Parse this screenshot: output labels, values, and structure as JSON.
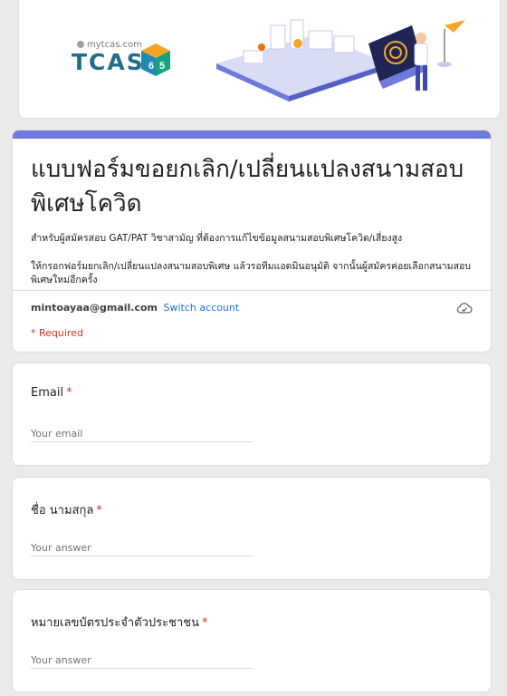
{
  "banner": {
    "logo_small": "mytcas.com",
    "logo_main": "TCAS",
    "logo_number": "65"
  },
  "form": {
    "title": "แบบฟอร์มขอยกเลิก/เปลี่ยนแปลงสนามสอบพิเศษโควิด",
    "description_1": "สำหรับผู้สมัครสอบ GAT/PAT วิชาสามัญ ที่ต้องการแก้ไขข้อมูลสนามสอบพิเศษโควิด/เสี่ยงสูง",
    "description_2": "ให้กรอกฟอร์มยกเลิก/เปลี่ยนแปลงสนามสอบพิเศษ แล้วรอทีมแอดมินอนุมัติ จากนั้นผู้สมัครค่อยเลือกสนามสอบพิเศษใหม่อีกครั้ง",
    "account_email": "mintoayaa@gmail.com",
    "switch_account": "Switch account",
    "required_note": "* Required",
    "accent_color": "#6f7ad9"
  },
  "questions": [
    {
      "label": "Email",
      "required_mark": "*",
      "placeholder": "Your email"
    },
    {
      "label": "ชื่อ นามสกุล",
      "required_mark": "*",
      "placeholder": "Your answer"
    },
    {
      "label": "หมายเลขบัตรประจำตัวประชาชน",
      "required_mark": "*",
      "placeholder": "Your answer"
    }
  ]
}
